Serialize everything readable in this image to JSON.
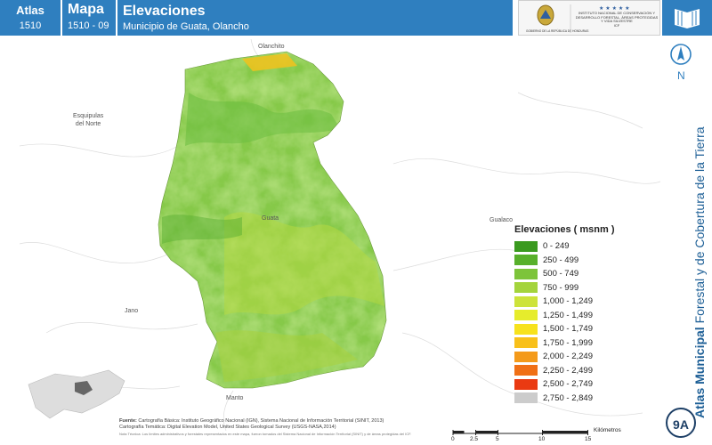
{
  "header": {
    "atlas_label": "Atlas",
    "atlas_number": "1510",
    "mapa_label": "Mapa",
    "mapa_number": "1510 - 09",
    "title": "Elevaciones",
    "subtitle": "Municipio de Guata, Olancho",
    "logo_left_text": "GOBIERNO DE LA REPÚBLICA DE HONDURAS",
    "logo_right_text": "INSTITUTO NACIONAL DE CONSERVACIÓN Y DESARROLLO FORESTAL, ÁREAS PROTEGIDAS Y VIDA SILVESTRE",
    "logo_right_abbr": "ICF"
  },
  "side": {
    "north_label": "N",
    "title_bold": "Atlas Municipal",
    "title_rest": " Forestal y de Cobertura de la Tierra",
    "badge": "9A"
  },
  "map": {
    "places": {
      "olanchito": "Olanchito",
      "esquipulas": "Esquipulas\ndel Norte",
      "guata": "Guata",
      "gualaco": "Gualaco",
      "jano": "Jano",
      "manto": "Manto"
    },
    "colors": {
      "base": "#7fc64a",
      "light": "#b6d83a",
      "dark": "#4fa838"
    }
  },
  "legend": {
    "title": "Elevaciones ( msnm )",
    "items": [
      {
        "label": "0 - 249",
        "color": "#3a9a1f"
      },
      {
        "label": "250 - 499",
        "color": "#58b02b"
      },
      {
        "label": "500 - 749",
        "color": "#7dc43a"
      },
      {
        "label": "750 - 999",
        "color": "#a4d43c"
      },
      {
        "label": "1,000 - 1,249",
        "color": "#cde33a"
      },
      {
        "label": "1,250 - 1,499",
        "color": "#e6ec2c"
      },
      {
        "label": "1,500 - 1,749",
        "color": "#f7e21c"
      },
      {
        "label": "1,750 - 1,999",
        "color": "#f8c01a"
      },
      {
        "label": "2,000 - 2,249",
        "color": "#f49a1a"
      },
      {
        "label": "2,250 - 2,499",
        "color": "#f07016"
      },
      {
        "label": "2,500 - 2,749",
        "color": "#ea3a12"
      },
      {
        "label": "2,750 - 2,849",
        "color": "#cccccc"
      }
    ]
  },
  "footer": {
    "fuente_label": "Fuente:",
    "fuente_1": "Cartografía Básica: Instituto Geográfico Nacional (IGN), Sistema Nacional de Información Territorial (SINIT, 2013)",
    "fuente_2": "Cartografía Temática: Digital Elevation Model, United States Geological Survey (USGS-NASA,2014)",
    "nota": "Nota Técnica: Los límites administrativos y forestales representados en este mapa, fueron tomados del Sistema Nacional de Información Territorial (SINIT) y de áreas protegidas del ICF."
  },
  "scale": {
    "ticks": [
      "0",
      "2.5",
      "5",
      "10",
      "15"
    ],
    "unit": "Kilómetros"
  }
}
